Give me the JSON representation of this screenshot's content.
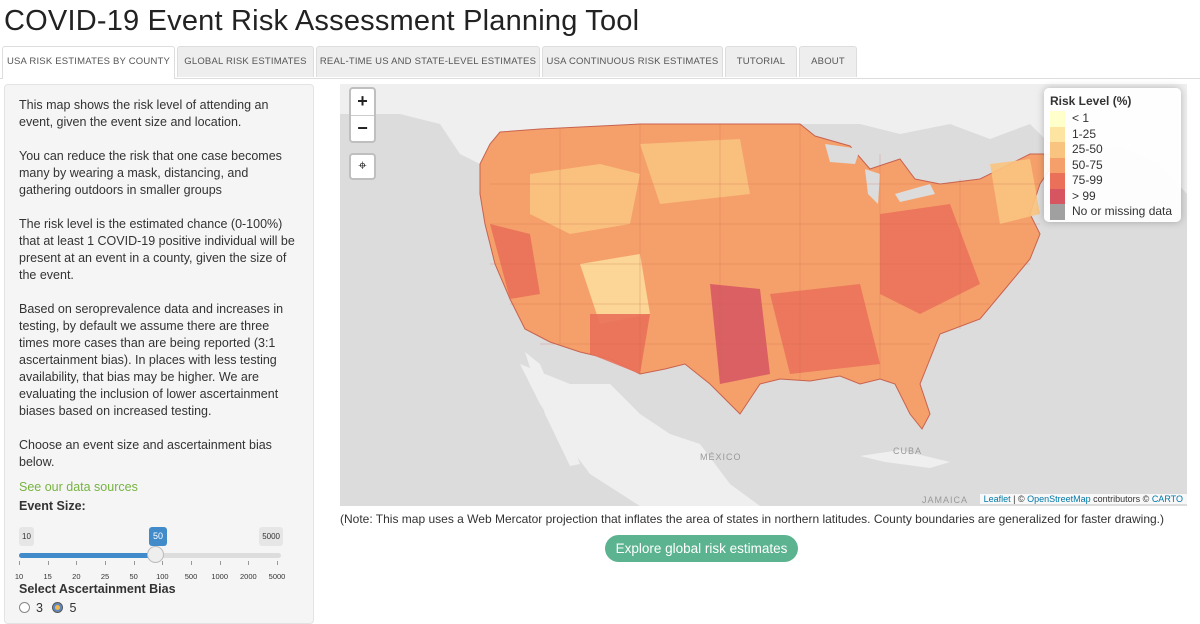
{
  "app": {
    "title": "COVID-19 Event Risk Assessment Planning Tool"
  },
  "tabs": [
    {
      "label": "USA RISK ESTIMATES BY COUNTY",
      "active": true
    },
    {
      "label": "GLOBAL RISK ESTIMATES"
    },
    {
      "label": "REAL-TIME US AND STATE-LEVEL ESTIMATES"
    },
    {
      "label": "USA CONTINUOUS RISK ESTIMATES"
    },
    {
      "label": "TUTORIAL"
    },
    {
      "label": "ABOUT"
    }
  ],
  "sidebar": {
    "p1": "This map shows the risk level of attending an event, given the event size and location.",
    "p2": "You can reduce the risk that one case becomes many by wearing a mask, distancing, and gathering outdoors in smaller groups",
    "p3": "The risk level is the estimated chance (0-100%) that at least 1 COVID-19 positive individual will be present at an event in a county, given the size of the event.",
    "p4": "Based on seroprevalence data and increases in testing, by default we assume there are three times more cases than are being reported (3:1 ascertainment bias). In places with less testing availability, that bias may be higher. We are evaluating the inclusion of lower ascertainment biases based on increased testing.",
    "p5": "Choose an event size and ascertainment bias below.",
    "data_link": "See our data sources",
    "event_size_label": "Event Size:",
    "slider": {
      "min": "10",
      "max": "5000",
      "value": "50",
      "ticks": [
        "10",
        "15",
        "20",
        "25",
        "50",
        "100",
        "500",
        "1000",
        "2000",
        "5000"
      ]
    },
    "bias_label": "Select Ascertainment Bias",
    "bias_options": [
      {
        "label": "3",
        "selected": false
      },
      {
        "label": "5",
        "selected": true
      }
    ]
  },
  "map": {
    "zoom_in": "+",
    "zoom_out": "−",
    "locate_icon": "crosshair-icon",
    "labels": {
      "mexico": "MÉXICO",
      "cuba": "CUBA",
      "jamaica": "JAMAICA"
    },
    "legend": {
      "title": "Risk Level (%)",
      "items": [
        {
          "label": "< 1",
          "color": "#ffffcc"
        },
        {
          "label": "1-25",
          "color": "#fde4a1"
        },
        {
          "label": "25-50",
          "color": "#f9c47f"
        },
        {
          "label": "50-75",
          "color": "#f5a06a"
        },
        {
          "label": "75-99",
          "color": "#ea7059"
        },
        {
          "label": "> 99",
          "color": "#d65561"
        },
        {
          "label": "No or missing data",
          "color": "#a0a0a0"
        }
      ]
    },
    "attribution": {
      "leaflet": "Leaflet",
      "sep1": " | © ",
      "osm": "OpenStreetMap",
      "mid": " contributors © ",
      "carto": "CARTO"
    }
  },
  "note": "(Note: This map uses a Web Mercator projection that inflates the area of states in northern latitudes. County boundaries are generalized for faster drawing.)",
  "explore_button": "Explore global risk estimates"
}
